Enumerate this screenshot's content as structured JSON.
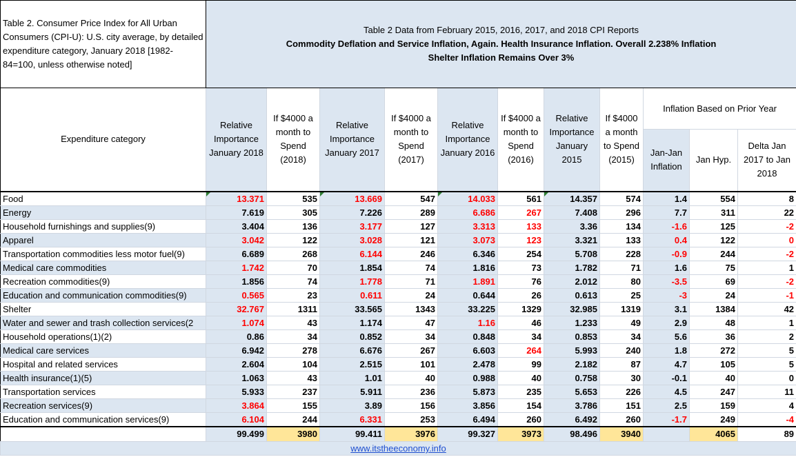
{
  "corner_title": "Table 2. Consumer Price Index for All Urban Consumers (CPI-U): U.S. city average, by detailed expenditure category, January 2018 [1982-84=100, unless otherwise noted]",
  "banner": {
    "line1": "Table 2 Data from February 2015, 2016, 2017, and 2018 CPI Reports",
    "line2": "Commodity Deflation and Service Inflation, Again. Health Insurance Inflation.  Overall 2.238% Inflation",
    "line3": "Shelter Inflation Remains Over 3%"
  },
  "headers": {
    "category": "Expenditure category",
    "ri2018": "Relative Importance January 2018",
    "spend2018": "If $4000 a month to Spend (2018)",
    "ri2017": "Relative Importance January 2017",
    "spend2017": "If $4000 a month to Spend (2017)",
    "ri2016": "Relative Importance January 2016",
    "spend2016": "If $4000 a month to Spend (2016)",
    "ri2015": "Relative Importance January 2015",
    "spend2015": "If $4000 a month to Spend (2015)",
    "inflation_group": "Inflation Based on Prior Year",
    "janjan": "Jan-Jan Inflation",
    "janhyp": "Jan Hyp.",
    "delta": "Delta Jan 2017 to Jan 2018"
  },
  "rows": [
    {
      "cat": "Food",
      "v": [
        "13.371",
        "535",
        "13.669",
        "547",
        "14.033",
        "561",
        "14.357",
        "574",
        "1.4",
        "554",
        "8"
      ],
      "red": [
        0,
        2,
        4
      ]
    },
    {
      "cat": "Energy",
      "v": [
        "7.619",
        "305",
        "7.226",
        "289",
        "6.686",
        "267",
        "7.408",
        "296",
        "7.7",
        "311",
        "22"
      ],
      "red": [
        4,
        5
      ]
    },
    {
      "cat": "Household furnishings and supplies(9)",
      "v": [
        "3.404",
        "136",
        "3.177",
        "127",
        "3.313",
        "133",
        "3.36",
        "134",
        "-1.6",
        "125",
        "-2"
      ],
      "red": [
        2,
        4,
        5,
        8,
        10
      ]
    },
    {
      "cat": "Apparel",
      "v": [
        "3.042",
        "122",
        "3.028",
        "121",
        "3.073",
        "123",
        "3.321",
        "133",
        "0.4",
        "122",
        "0"
      ],
      "red": [
        0,
        2,
        4,
        5,
        8,
        10
      ]
    },
    {
      "cat": "Transportation commodities less motor fuel(9)",
      "v": [
        "6.689",
        "268",
        "6.144",
        "246",
        "6.346",
        "254",
        "5.708",
        "228",
        "-0.9",
        "244",
        "-2"
      ],
      "red": [
        2,
        8,
        10
      ]
    },
    {
      "cat": "Medical care commodities",
      "v": [
        "1.742",
        "70",
        "1.854",
        "74",
        "1.816",
        "73",
        "1.782",
        "71",
        "1.6",
        "75",
        "1"
      ],
      "red": [
        0
      ]
    },
    {
      "cat": "Recreation commodities(9)",
      "v": [
        "1.856",
        "74",
        "1.778",
        "71",
        "1.891",
        "76",
        "2.012",
        "80",
        "-3.5",
        "69",
        "-2"
      ],
      "red": [
        2,
        4,
        8,
        10
      ]
    },
    {
      "cat": "Education and communication commodities(9)",
      "v": [
        "0.565",
        "23",
        "0.611",
        "24",
        "0.644",
        "26",
        "0.613",
        "25",
        "-3",
        "24",
        "-1"
      ],
      "red": [
        0,
        2,
        8,
        10
      ]
    },
    {
      "cat": "Shelter",
      "v": [
        "32.767",
        "1311",
        "33.565",
        "1343",
        "33.225",
        "1329",
        "32.985",
        "1319",
        "3.1",
        "1384",
        "42"
      ],
      "red": [
        0
      ]
    },
    {
      "cat": "Water and sewer and trash collection services(2",
      "v": [
        "1.074",
        "43",
        "1.174",
        "47",
        "1.16",
        "46",
        "1.233",
        "49",
        "2.9",
        "48",
        "1"
      ],
      "red": [
        0,
        4
      ]
    },
    {
      "cat": "Household operations(1)(2)",
      "v": [
        "0.86",
        "34",
        "0.852",
        "34",
        "0.848",
        "34",
        "0.853",
        "34",
        "5.6",
        "36",
        "2"
      ],
      "red": []
    },
    {
      "cat": "Medical care services",
      "v": [
        "6.942",
        "278",
        "6.676",
        "267",
        "6.603",
        "264",
        "5.993",
        "240",
        "1.8",
        "272",
        "5"
      ],
      "red": [
        5
      ]
    },
    {
      "cat": "Hospital and related services",
      "v": [
        "2.604",
        "104",
        "2.515",
        "101",
        "2.478",
        "99",
        "2.182",
        "87",
        "4.7",
        "105",
        "5"
      ],
      "red": []
    },
    {
      "cat": "Health insurance(1)(5)",
      "v": [
        "1.063",
        "43",
        "1.01",
        "40",
        "0.988",
        "40",
        "0.758",
        "30",
        "-0.1",
        "40",
        "0"
      ],
      "red": []
    },
    {
      "cat": "Transportation services",
      "v": [
        "5.933",
        "237",
        "5.911",
        "236",
        "5.873",
        "235",
        "5.653",
        "226",
        "4.5",
        "247",
        "11"
      ],
      "red": []
    },
    {
      "cat": "Recreation services(9)",
      "v": [
        "3.864",
        "155",
        "3.89",
        "156",
        "3.856",
        "154",
        "3.786",
        "151",
        "2.5",
        "159",
        "4"
      ],
      "red": [
        0
      ]
    },
    {
      "cat": "Education and communication services(9)",
      "v": [
        "6.104",
        "244",
        "6.331",
        "253",
        "6.494",
        "260",
        "6.492",
        "260",
        "-1.7",
        "249",
        "-4"
      ],
      "red": [
        0,
        2,
        8,
        10
      ]
    }
  ],
  "totals": [
    "99.499",
    "3980",
    "99.411",
    "3976",
    "99.327",
    "3973",
    "98.496",
    "3940",
    "",
    "4065",
    "89"
  ],
  "footer_link": "www.itstheeconomy.info",
  "colors": {
    "red": "#ff0000",
    "blue_fill": "#dce6f1",
    "yellow_fill": "#ffe699",
    "link": "#1f4fd0"
  }
}
